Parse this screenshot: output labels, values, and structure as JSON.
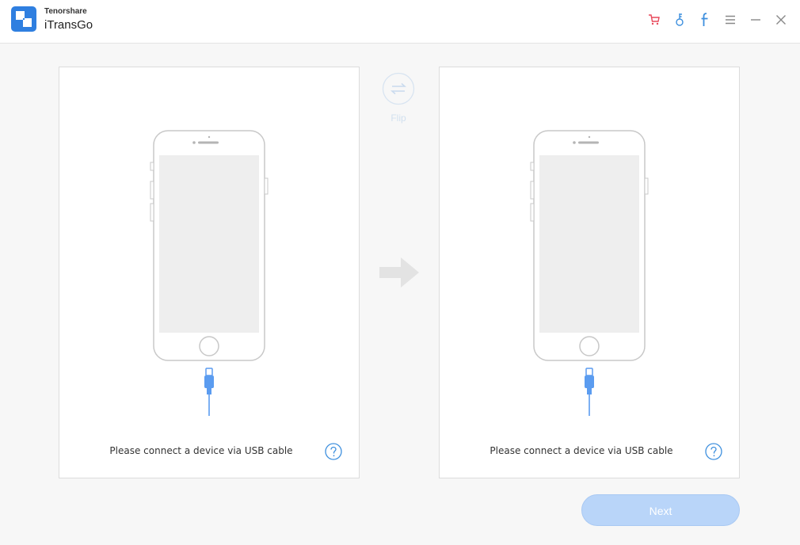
{
  "app": {
    "company": "Tenorshare",
    "product": "iTransGo"
  },
  "titlebar": {
    "icons": [
      "cart-icon",
      "key-icon",
      "facebook-icon",
      "menu-icon",
      "minimize-icon",
      "close-icon"
    ],
    "colors": {
      "cart": "#e8495b",
      "key": "#3d8fde",
      "facebook": "#3d8fde",
      "controls": "#888888"
    }
  },
  "source_panel": {
    "instruction": "Please connect a device via USB cable",
    "help_icon": "question-circle-icon"
  },
  "target_panel": {
    "instruction": "Please connect a device via USB cable",
    "help_icon": "question-circle-icon"
  },
  "flip": {
    "label": "Flip",
    "icon": "swap-arrows-icon"
  },
  "next_button": {
    "label": "Next",
    "state": "disabled"
  },
  "colors": {
    "accent": "#3d8fde",
    "cable": "#5b9cf0",
    "next_bg": "#b9d5f9",
    "phone_outline": "#c8c8c8",
    "phone_screen": "#eeeeee"
  }
}
